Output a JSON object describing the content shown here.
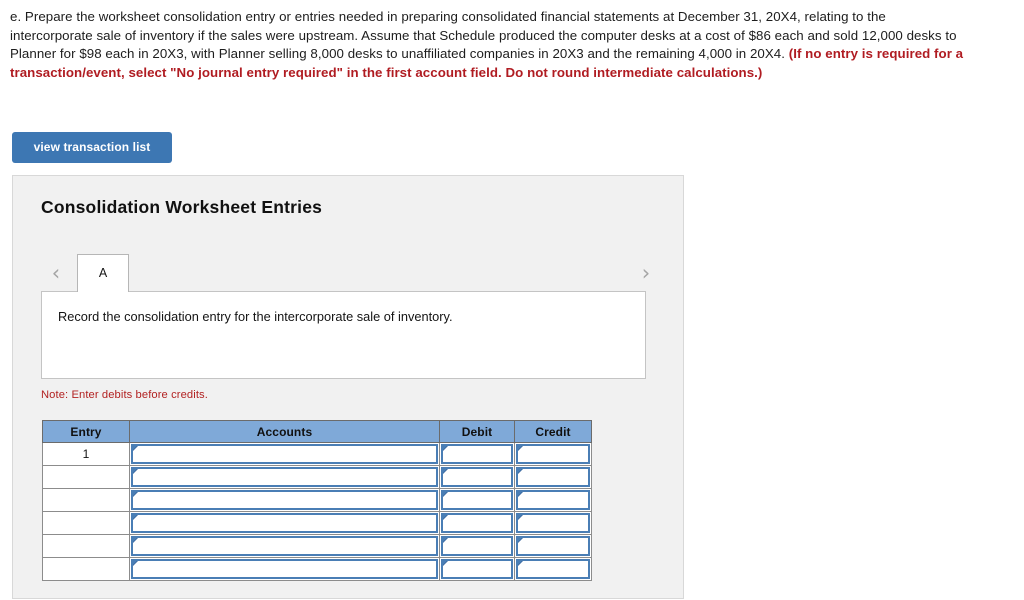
{
  "question": {
    "plain_before": "e. Prepare the worksheet consolidation entry or entries needed in preparing consolidated financial statements at December 31, 20X4, relating to the intercorporate sale of inventory if the sales were upstream. Assume that Schedule produced the computer desks at a cost of $86 each and sold 12,000 desks to Planner for $98 each in 20X3, with Planner selling 8,000 desks to unaffiliated companies in 20X3 and the remaining 4,000 in 20X4. ",
    "red_emphasis": "(If no entry is required for a transaction/event, select \"No journal entry required\" in the first account field. Do not round intermediate calculations.)"
  },
  "toolbar": {
    "view_transaction_list_label": "view transaction list"
  },
  "card": {
    "title": "Consolidation Worksheet Entries",
    "tabs": [
      {
        "label": "A",
        "selected": true
      }
    ],
    "nav": {
      "prev_icon": "chevron-left-icon",
      "next_icon": "chevron-right-icon",
      "prev_glyph": "‹",
      "next_glyph": "›"
    },
    "instruction": "Record the consolidation entry for the intercorporate sale of inventory.",
    "note": "Note: Enter debits before credits."
  },
  "journal_table": {
    "columns": [
      "Entry",
      "Accounts",
      "Debit",
      "Credit"
    ],
    "rows": [
      {
        "entry": "1",
        "accounts": "",
        "debit": "",
        "credit": ""
      },
      {
        "entry": "",
        "accounts": "",
        "debit": "",
        "credit": ""
      },
      {
        "entry": "",
        "accounts": "",
        "debit": "",
        "credit": ""
      },
      {
        "entry": "",
        "accounts": "",
        "debit": "",
        "credit": ""
      },
      {
        "entry": "",
        "accounts": "",
        "debit": "",
        "credit": ""
      },
      {
        "entry": "",
        "accounts": "",
        "debit": "",
        "credit": ""
      }
    ]
  },
  "colors": {
    "button_blue": "#3d77b3",
    "header_blue": "#7fa9d8",
    "input_border_blue": "#4a7eb5",
    "note_red": "#b22222",
    "emphasis_red": "#b01c22",
    "card_bg": "#f1f1f1"
  }
}
